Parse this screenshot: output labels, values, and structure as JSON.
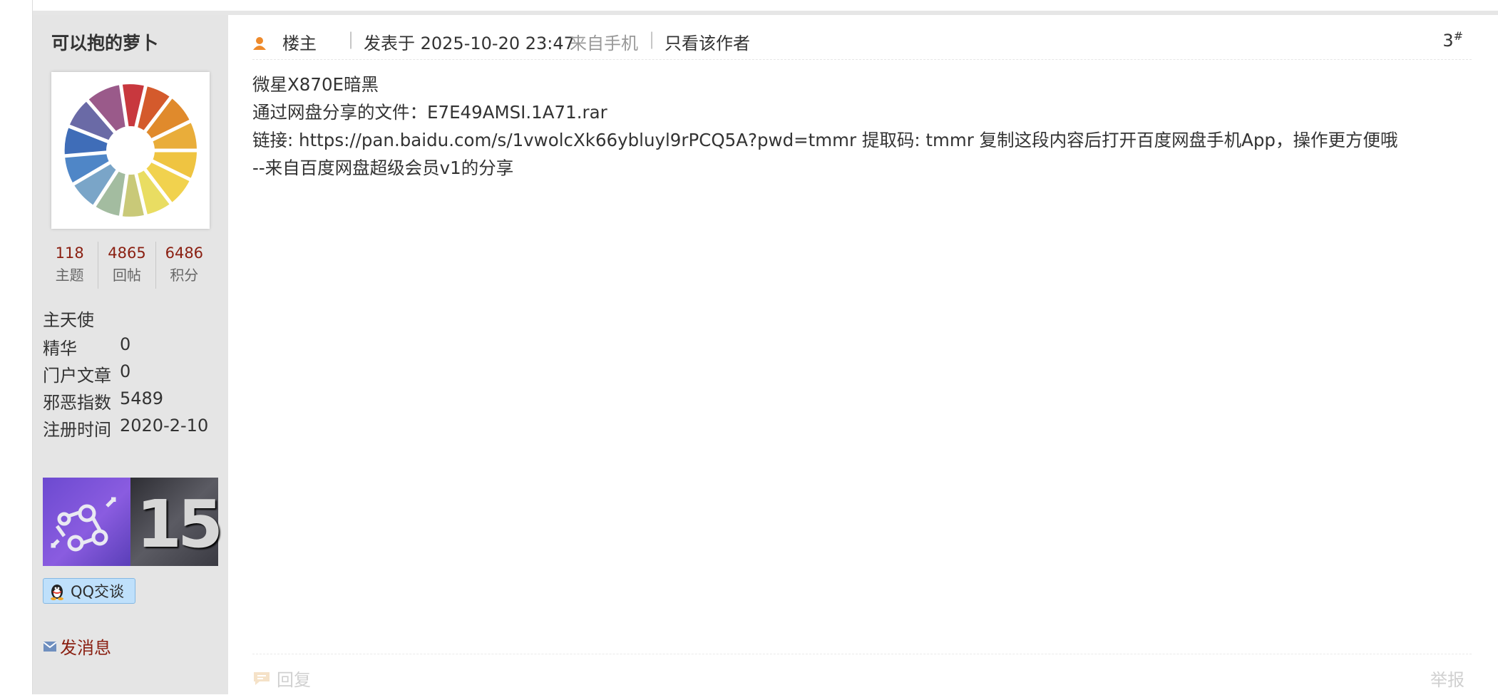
{
  "sidebar": {
    "username": "可以抱的萝卜",
    "stats": [
      {
        "value": "118",
        "label": "主题"
      },
      {
        "value": "4865",
        "label": "回帖"
      },
      {
        "value": "6486",
        "label": "积分"
      }
    ],
    "rank": "主天使",
    "info": [
      {
        "key": "精华",
        "value": "0"
      },
      {
        "key": "门户文章",
        "value": "0"
      },
      {
        "key": "邪恶指数",
        "value": "5489"
      },
      {
        "key": "注册时间",
        "value": "2020-2-10"
      }
    ],
    "medal_number": "15",
    "qq_label": "QQ交谈",
    "message_label": "发消息"
  },
  "post": {
    "role": "楼主",
    "separator": "|",
    "date_label": "发表于 2025-10-20 23:47",
    "source": "来自手机",
    "only_author": "只看该作者",
    "floor": "3",
    "floor_mark": "#",
    "lines": [
      "微星X870E暗黑",
      "通过网盘分享的文件：E7E49AMSI.1A71.rar",
      "链接: https://pan.baidu.com/s/1vwolcXk66ybluyl9rPCQ5A?pwd=tmmr 提取码: tmmr 复制这段内容后打开百度网盘手机App，操作更方便哦",
      "--来自百度网盘超级会员v1的分享"
    ],
    "reply_label": "回复",
    "report_label": "举报"
  },
  "colors": {
    "accent_red": "#8a1f11",
    "sidebar_bg": "#e5e5e5",
    "qq_bg": "#bfe0fb"
  }
}
